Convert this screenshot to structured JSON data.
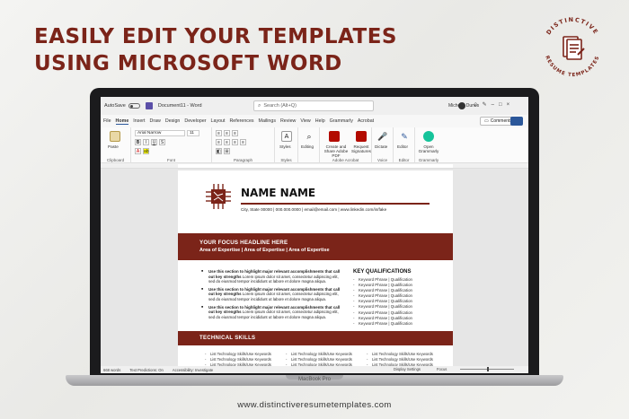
{
  "headline": [
    "EASILY EDIT YOUR TEMPLATES",
    "USING MICROSOFT WORD"
  ],
  "brand": {
    "line1": "DISTINCTIVE",
    "line2": "RESUME TEMPLATES",
    "color": "#7b2419"
  },
  "footer_url": "www.distinctiveresumetemplates.com",
  "device": {
    "model": "MacBook Pro"
  },
  "word": {
    "autosave_label": "AutoSave",
    "doc_title": "Document11 - Word",
    "search_placeholder": "Search (Alt+Q)",
    "user_name": "Michelle Dunes",
    "menu": [
      "File",
      "Home",
      "Insert",
      "Draw",
      "Design",
      "Developer",
      "Layout",
      "References",
      "Mailings",
      "Review",
      "View",
      "Help",
      "Grammarly",
      "Acrobat"
    ],
    "active_tab": "Home",
    "comments_label": "Comments",
    "ribbon": {
      "paste": "Paste",
      "font_name": "Arial Narrow",
      "font_size": "11",
      "styles": "Styles",
      "editing": "Editing",
      "create_share": "Create and Share Adobe PDF",
      "request_sign": "Request Signatures",
      "dictate": "Dictate",
      "editor": "Editor",
      "grammarly": "Open Grammarly",
      "groups": [
        "Clipboard",
        "Font",
        "Paragraph",
        "Styles",
        "Adobe Acrobat",
        "Voice",
        "Editor",
        "Grammarly"
      ]
    },
    "status": {
      "words": "668 words",
      "predictions": "Text Predictions: On",
      "accessibility": "Accessibility: Investigate",
      "display": "Display Settings",
      "focus": "Focus",
      "zoom_fraction": 0.5
    }
  },
  "resume": {
    "name": "NAME NAME",
    "contact": "City, State 00000 | 000.000.0000 | email@email.com | www.linkedin.com/in/fake",
    "focus_headline": "YOUR FOCUS HEADLINE HERE",
    "expertise": "Area of Expertise | Area of Expertise | Area of Expertise",
    "bullets": [
      {
        "bold": "Use this section to highlight major relevant accomplishments that call out key strengths",
        "text": " Lorem ipsum dolor sit amet, consectetur adipiscing elit, sed do eiusmod tempor incididunt ut labore et dolore magna aliqua."
      },
      {
        "bold": "Use this section to highlight major relevant accomplishments that call out key strengths",
        "text": " Lorem ipsum dolor sit amet, consectetur adipiscing elit, sed do eiusmod tempor incididunt ut labore et dolore magna aliqua."
      },
      {
        "bold": "Use this section to highlight major relevant accomplishments that call out key strengths",
        "text": " Lorem ipsum dolor sit amet, consectetur adipiscing elit, sed do eiusmod tempor incididunt ut labore et dolore magna aliqua."
      }
    ],
    "kq_title": "KEY QUALIFICATIONS",
    "kq_items": [
      "Keyword Phrase | Qualification",
      "Keyword Phrase | Qualification",
      "Keyword Phrase | Qualification",
      "Keyword Phrase | Qualification",
      "Keyword Phrase | Qualification",
      "Keyword Phrase | Qualification",
      "Keyword Phrase | Qualification",
      "Keyword Phrase | Qualification",
      "Keyword Phrase | Qualification"
    ],
    "tech_title": "TECHNICAL SKILLS",
    "tech_items": [
      "List Technology Skills/Use Keywords",
      "List Technology Skills/Use Keywords",
      "List Technology Skills/Use Keywords",
      "List Technology Skills/Use Keywords",
      "List Technology Skills/Use Keywords",
      "List Technology Skills/Use Keywords",
      "List Technology Skills/Use Keywords",
      "List Technology Skills/Use Keywords",
      "List Technology Skills/Use Keywords"
    ],
    "accent": "#7b2419"
  }
}
